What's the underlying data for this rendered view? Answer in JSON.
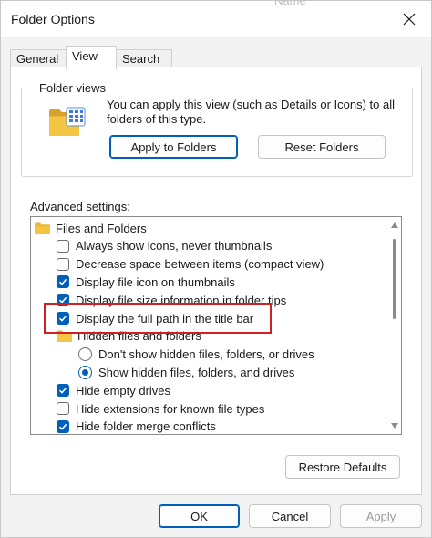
{
  "window": {
    "title": "Folder Options",
    "background_text": "Name"
  },
  "tabs": [
    {
      "label": "General",
      "active": false
    },
    {
      "label": "View",
      "active": true
    },
    {
      "label": "Search",
      "active": false
    }
  ],
  "folder_views": {
    "label": "Folder views",
    "description": "You can apply this view (such as Details or Icons) to all folders of this type.",
    "apply_button": "Apply to Folders",
    "reset_button": "Reset Folders"
  },
  "advanced": {
    "label": "Advanced settings:",
    "items": [
      {
        "type": "folder",
        "label": "Files and Folders",
        "indent": 0
      },
      {
        "type": "checkbox",
        "label": "Always show icons, never thumbnails",
        "checked": false,
        "indent": 1
      },
      {
        "type": "checkbox",
        "label": "Decrease space between items (compact view)",
        "checked": false,
        "indent": 1
      },
      {
        "type": "checkbox",
        "label": "Display file icon on thumbnails",
        "checked": true,
        "indent": 1
      },
      {
        "type": "checkbox",
        "label": "Display file size information in folder tips",
        "checked": true,
        "indent": 1
      },
      {
        "type": "checkbox",
        "label": "Display the full path in the title bar",
        "checked": true,
        "indent": 1
      },
      {
        "type": "folder",
        "label": "Hidden files and folders",
        "indent": 1
      },
      {
        "type": "radio",
        "label": "Don't show hidden files, folders, or drives",
        "checked": false,
        "indent": 2
      },
      {
        "type": "radio",
        "label": "Show hidden files, folders, and drives",
        "checked": true,
        "indent": 2
      },
      {
        "type": "checkbox",
        "label": "Hide empty drives",
        "checked": true,
        "indent": 1
      },
      {
        "type": "checkbox",
        "label": "Hide extensions for known file types",
        "checked": false,
        "indent": 1
      },
      {
        "type": "checkbox",
        "label": "Hide folder merge conflicts",
        "checked": true,
        "indent": 1
      }
    ]
  },
  "restore_defaults": "Restore Defaults",
  "footer": {
    "ok": "OK",
    "cancel": "Cancel",
    "apply": "Apply"
  },
  "colors": {
    "accent": "#005fb8",
    "highlight": "#d01f25",
    "folder": "#f4c542"
  }
}
